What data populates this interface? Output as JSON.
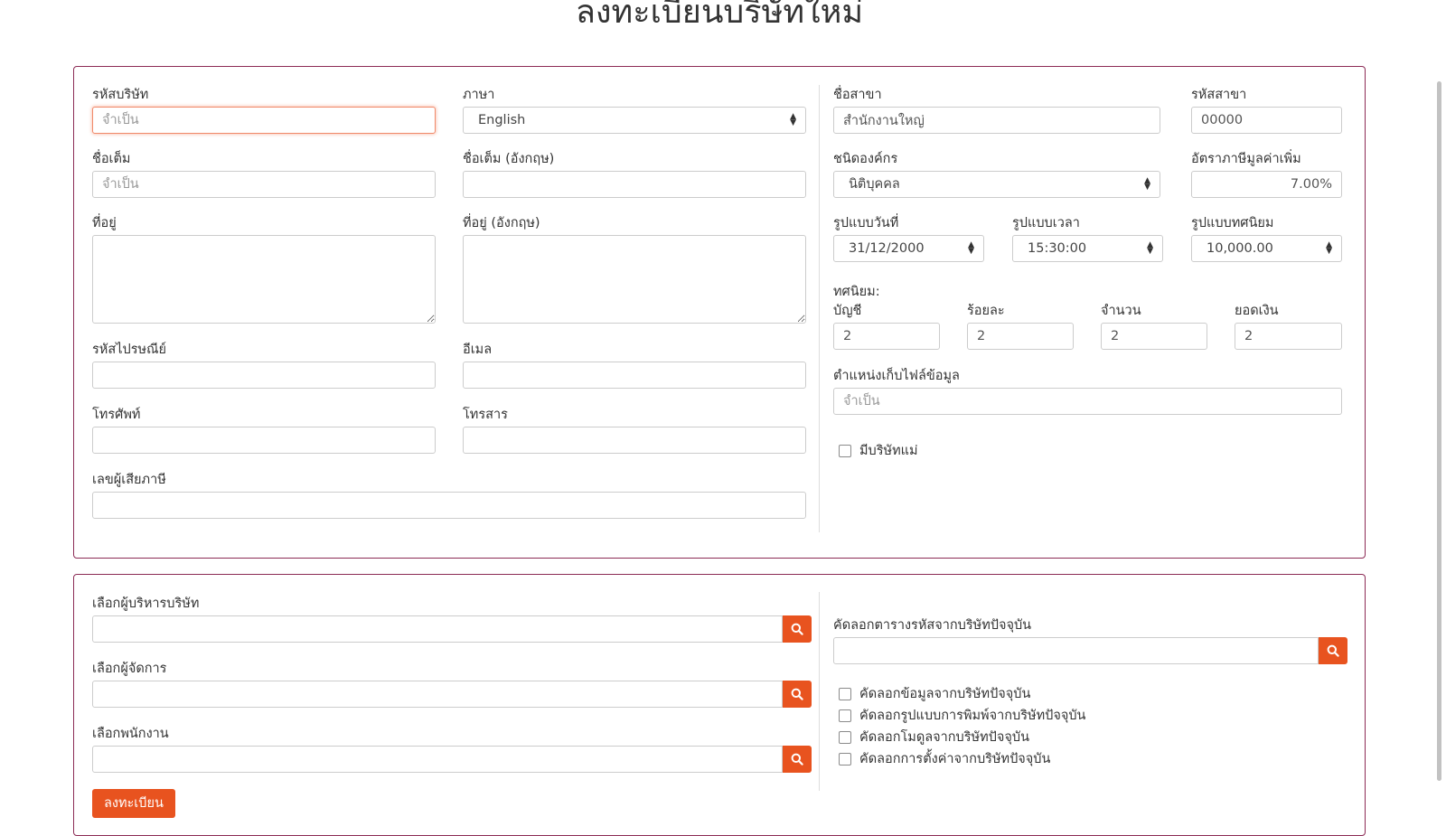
{
  "page_title": "ลงทะเบียนบริษัทใหม่",
  "form": {
    "company_code": {
      "label": "รหัสบริษัท",
      "placeholder": "จำเป็น",
      "value": ""
    },
    "language": {
      "label": "ภาษา",
      "value": "English"
    },
    "full_name": {
      "label": "ชื่อเต็ม",
      "placeholder": "จำเป็น",
      "value": ""
    },
    "full_name_en": {
      "label": "ชื่อเต็ม (อังกฤษ)",
      "value": ""
    },
    "address": {
      "label": "ที่อยู่",
      "value": ""
    },
    "address_en": {
      "label": "ที่อยู่ (อังกฤษ)",
      "value": ""
    },
    "postal_code": {
      "label": "รหัสไปรษณีย์",
      "value": ""
    },
    "email": {
      "label": "อีเมล",
      "value": ""
    },
    "phone": {
      "label": "โทรศัพท์",
      "value": ""
    },
    "fax": {
      "label": "โทรสาร",
      "value": ""
    },
    "tax_id": {
      "label": "เลขผู้เสียภาษี",
      "value": ""
    },
    "branch_name": {
      "label": "ชื่อสาขา",
      "value": "สำนักงานใหญ่"
    },
    "branch_code": {
      "label": "รหัสสาขา",
      "value": "00000"
    },
    "org_type": {
      "label": "ชนิดองค์กร",
      "value": "นิติบุคคล"
    },
    "vat_rate": {
      "label": "อัตราภาษีมูลค่าเพิ่ม",
      "value": "7.00%"
    },
    "date_format": {
      "label": "รูปแบบวันที่",
      "value": "31/12/2000"
    },
    "time_format": {
      "label": "รูปแบบเวลา",
      "value": "15:30:00"
    },
    "decimal_format": {
      "label": "รูปแบบทศนิยม",
      "value": "10,000.00"
    },
    "decimals": {
      "heading": "ทศนิยม:",
      "account": {
        "label": "บัญชี",
        "value": "2"
      },
      "percent": {
        "label": "ร้อยละ",
        "value": "2"
      },
      "quantity": {
        "label": "จำนวน",
        "value": "2"
      },
      "amount": {
        "label": "ยอดเงิน",
        "value": "2"
      }
    },
    "data_file_location": {
      "label": "ตำแหน่งเก็บไฟล์ข้อมูล",
      "placeholder": "จำเป็น",
      "value": ""
    },
    "has_parent": {
      "label": "มีบริษัทแม่",
      "checked": false
    }
  },
  "assignments": {
    "company_admin": {
      "label": "เลือกผู้บริหารบริษัท",
      "value": ""
    },
    "manager": {
      "label": "เลือกผู้จัดการ",
      "value": ""
    },
    "employee": {
      "label": "เลือกพนักงาน",
      "value": ""
    },
    "copy_code_table": {
      "label": "คัดลอกตารางรหัสจากบริษัทปัจจุบัน",
      "value": ""
    },
    "copy_options": [
      {
        "label": "คัดลอกข้อมูลจากบริษัทปัจจุบัน",
        "checked": false
      },
      {
        "label": "คัดลอกรูปแบบการพิมพ์จากบริษัทปัจจุบัน",
        "checked": false
      },
      {
        "label": "คัดลอกโมดูลจากบริษัทปัจจุบัน",
        "checked": false
      },
      {
        "label": "คัดลอกการตั้งค่าจากบริษัทปัจจุบัน",
        "checked": false
      }
    ],
    "register_label": "ลงทะเบียน"
  },
  "colors": {
    "accent": "#e8531f",
    "panel_border": "#8c2b55",
    "focus_border": "#f08a6a"
  }
}
